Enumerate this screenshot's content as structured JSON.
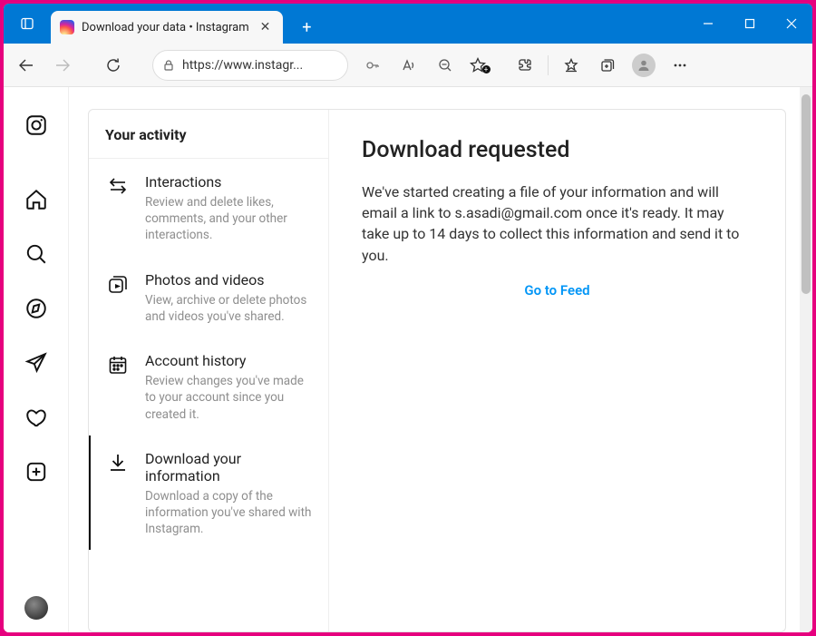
{
  "browser": {
    "tab_title": "Download your data • Instagram",
    "url": "https://www.instagr..."
  },
  "rail": {
    "logo": "instagram-logo",
    "items": [
      "home",
      "search",
      "explore",
      "messages",
      "notifications",
      "create",
      "profile"
    ]
  },
  "sidebar": {
    "header": "Your activity",
    "items": [
      {
        "icon": "interactions-icon",
        "title": "Interactions",
        "desc": "Review and delete likes, comments, and your other interactions."
      },
      {
        "icon": "photos-videos-icon",
        "title": "Photos and videos",
        "desc": "View, archive or delete photos and videos you've shared."
      },
      {
        "icon": "calendar-icon",
        "title": "Account history",
        "desc": "Review changes you've made to your account since you created it."
      },
      {
        "icon": "download-icon",
        "title": "Download your information",
        "desc": "Download a copy of the information you've shared with Instagram."
      }
    ]
  },
  "main": {
    "heading": "Download requested",
    "body": "We've started creating a file of your information and will email a link to s.asadi@gmail.com once it's ready. It may take up to 14 days to collect this information and send it to you.",
    "feed_link": "Go to Feed"
  }
}
